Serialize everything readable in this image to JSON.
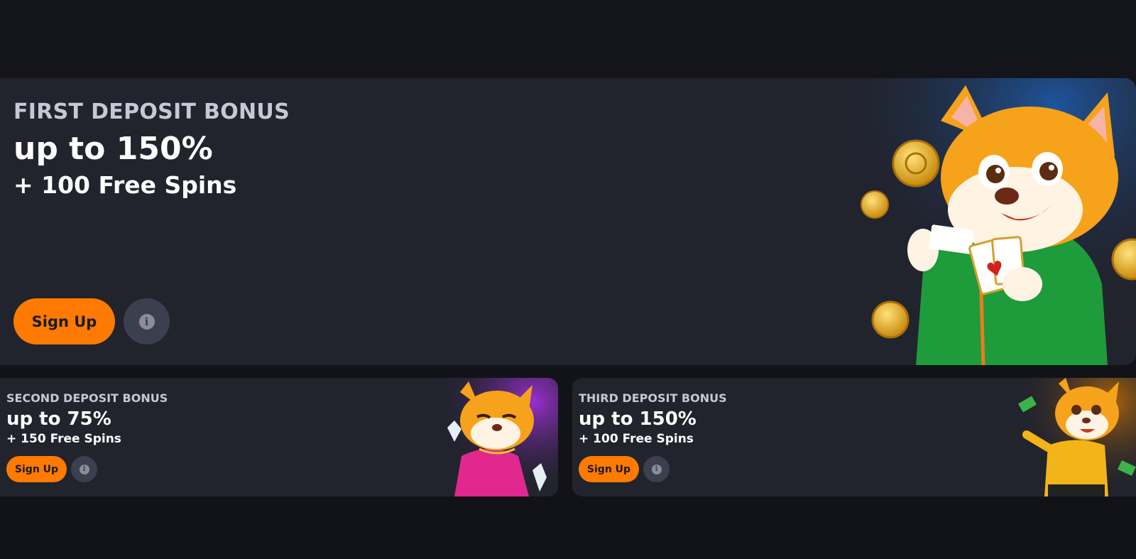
{
  "promos": {
    "first": {
      "eyebrow": "FIRST DEPOSIT BONUS",
      "headline": "up to 150%",
      "sub": "+ 100 Free Spins",
      "signup_label": "Sign Up",
      "info_glyph": "i"
    },
    "second": {
      "eyebrow": "SECOND DEPOSIT BONUS",
      "headline": "up to 75%",
      "sub": "+ 150 Free Spins",
      "signup_label": "Sign Up",
      "info_glyph": "i"
    },
    "third": {
      "eyebrow": "THIRD DEPOSIT BONUS",
      "headline": "up to 150%",
      "sub": "+ 100 Free Spins",
      "signup_label": "Sign Up",
      "info_glyph": "i"
    }
  },
  "icons": {
    "info": "info-icon",
    "hero_mascot": "fox-mascot-with-cards-illustration",
    "second_mascot": "fox-mascot-pink-dress-illustration",
    "third_mascot": "fox-mascot-yellow-shirt-illustration"
  },
  "colors": {
    "page_bg": "#13141a",
    "card_bg": "#21232d",
    "accent": "#ff7a00",
    "eyebrow_text": "#c5c9d6",
    "info_button": "#3c3f4d"
  }
}
